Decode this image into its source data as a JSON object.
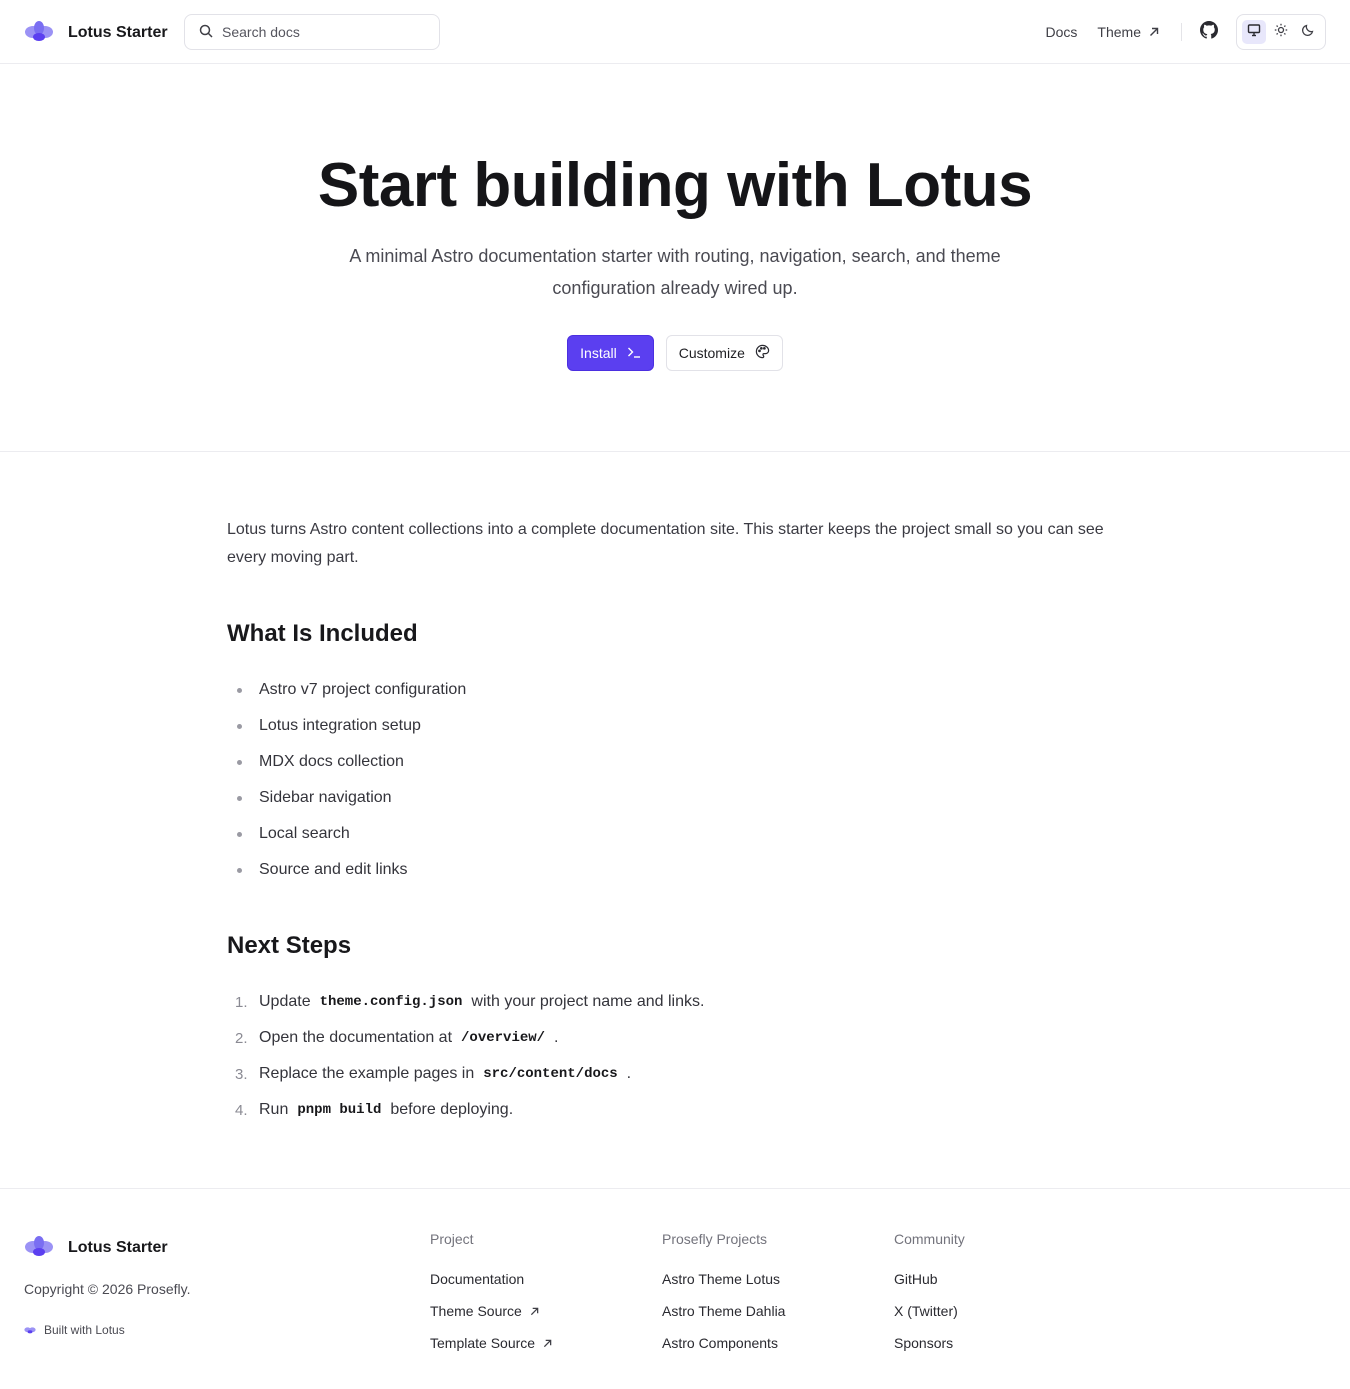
{
  "header": {
    "brand": "Lotus Starter",
    "search_placeholder": "Search docs",
    "nav": [
      {
        "label": "Docs",
        "external": false
      },
      {
        "label": "Theme",
        "external": true
      }
    ]
  },
  "hero": {
    "title": "Start building with Lotus",
    "subtitle": "A minimal Astro documentation starter with routing, navigation, search, and theme configuration already wired up.",
    "install_label": "Install",
    "customize_label": "Customize"
  },
  "content": {
    "intro": "Lotus turns Astro content collections into a complete documentation site. This starter keeps the project small so you can see every moving part.",
    "included_heading": "What Is Included",
    "included": [
      "Astro v7 project configuration",
      "Lotus integration setup",
      "MDX docs collection",
      "Sidebar navigation",
      "Local search",
      "Source and edit links"
    ],
    "next_heading": "Next Steps",
    "steps": [
      {
        "num": "1.",
        "before": "Update",
        "code": "theme.config.json",
        "after": "with your project name and links."
      },
      {
        "num": "2.",
        "before": "Open the documentation at",
        "code": "/overview/",
        "after": "."
      },
      {
        "num": "3.",
        "before": "Replace the example pages in",
        "code": "src/content/docs",
        "after": "."
      },
      {
        "num": "4.",
        "before": "Run",
        "code": "pnpm build",
        "after": "before deploying."
      }
    ]
  },
  "footer": {
    "brand": "Lotus Starter",
    "copyright": "Copyright © 2026 Prosefly.",
    "built_with": "Built with Lotus",
    "columns": [
      {
        "title": "Project",
        "links": [
          {
            "label": "Documentation",
            "external": false
          },
          {
            "label": "Theme Source",
            "external": true
          },
          {
            "label": "Template Source",
            "external": true
          }
        ]
      },
      {
        "title": "Prosefly Projects",
        "links": [
          {
            "label": "Astro Theme Lotus",
            "external": false
          },
          {
            "label": "Astro Theme Dahlia",
            "external": false
          },
          {
            "label": "Astro Components",
            "external": false
          }
        ]
      },
      {
        "title": "Community",
        "links": [
          {
            "label": "GitHub",
            "external": false
          },
          {
            "label": "X (Twitter)",
            "external": false
          },
          {
            "label": "Sponsors",
            "external": false
          }
        ]
      }
    ]
  },
  "colors": {
    "accent": "#5b3ff0",
    "logo_light": "#9b92f5",
    "logo_dark": "#5b3ff0",
    "border": "#ececf0"
  },
  "icons": [
    "lotus-logo-icon",
    "search-icon",
    "external-arrow-icon",
    "github-icon",
    "monitor-icon",
    "sun-icon",
    "moon-icon",
    "terminal-icon",
    "palette-icon"
  ]
}
